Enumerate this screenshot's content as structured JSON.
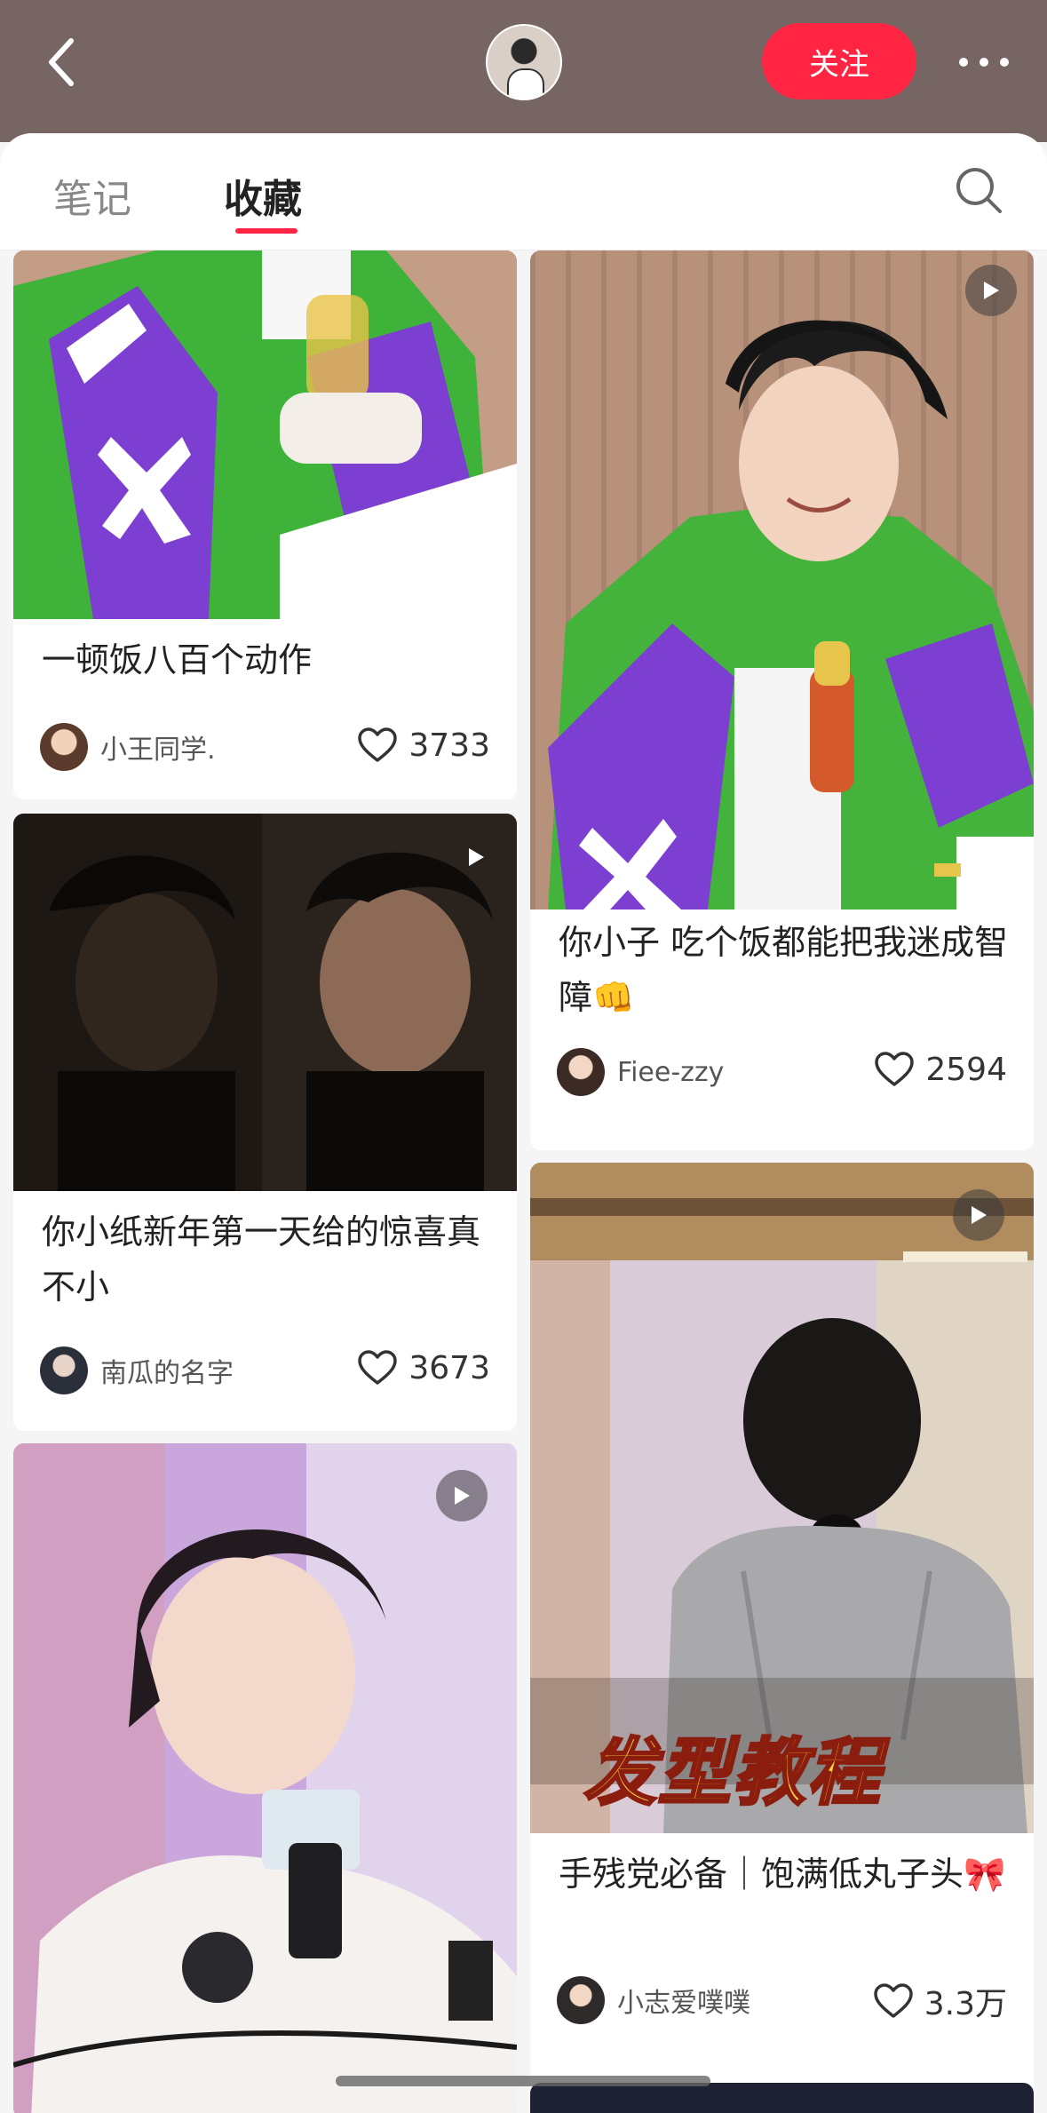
{
  "header": {
    "follow_label": "关注"
  },
  "tabs": [
    {
      "label": "笔记",
      "active": false
    },
    {
      "label": "收藏",
      "active": true
    }
  ],
  "colors": {
    "header_bg": "#776563",
    "accent": "#ff2442"
  },
  "cards": [
    {
      "title": "一顿饭八百个动作",
      "author": "小王同学.",
      "likes": "3733",
      "is_video": false
    },
    {
      "title": "你小子 吃个饭都能把我迷成智障👊",
      "author": "Fiee-zzy",
      "likes": "2594",
      "is_video": true
    },
    {
      "title": "你小纸新年第一天给的惊喜真不小",
      "author": "南瓜的名字",
      "likes": "3673",
      "is_video": true
    },
    {
      "title": "手残党必备｜饱满低丸子头🎀",
      "author": "小志爱噗噗",
      "likes": "3.3万",
      "is_video": true,
      "image_text": "发型教程"
    },
    {
      "title": "",
      "author": "",
      "likes": "",
      "is_video": true
    }
  ],
  "icons": [
    "back-arrow-icon",
    "more-dots-icon",
    "search-icon",
    "heart-icon",
    "play-icon"
  ]
}
